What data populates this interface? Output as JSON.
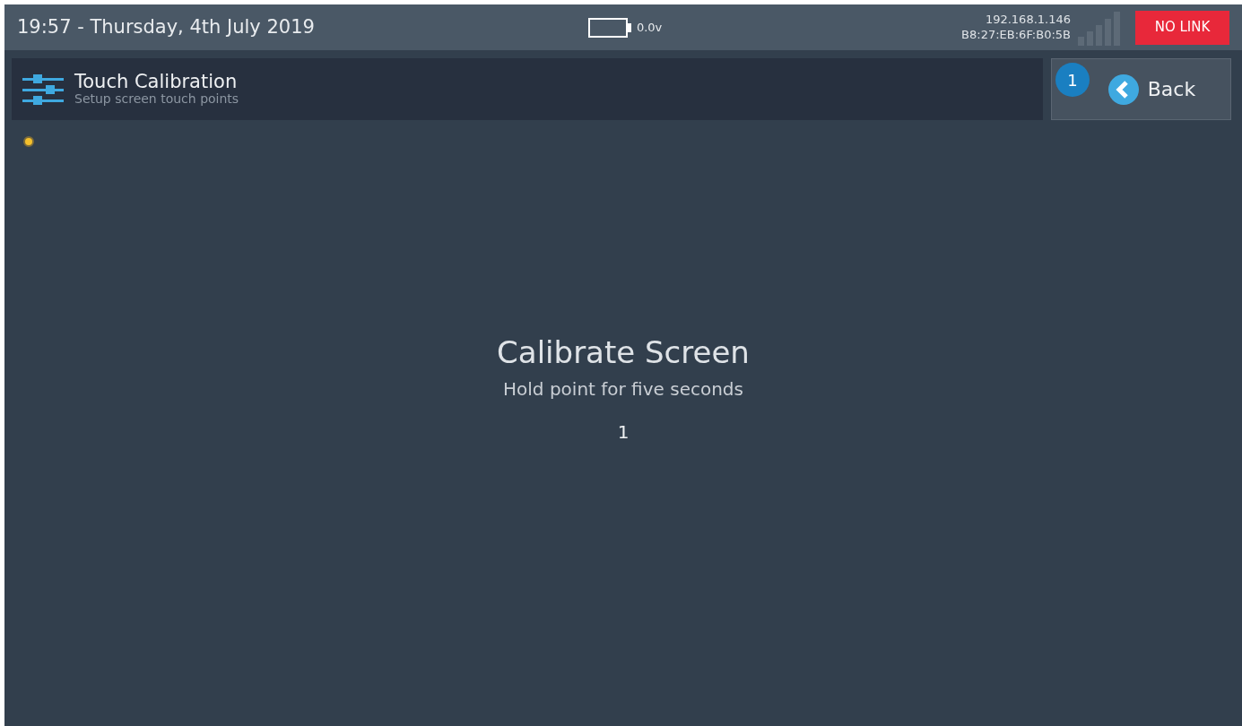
{
  "status_bar": {
    "datetime": "19:57 - Thursday, 4th July 2019",
    "voltage": "0.0v",
    "ip_address": "192.168.1.146",
    "mac_address": "B8:27:EB:6F:B0:5B",
    "link_status": "NO LINK"
  },
  "header": {
    "title": "Touch Calibration",
    "subtitle": "Setup screen touch points"
  },
  "back_button": {
    "label": "Back",
    "badge": "1"
  },
  "calibration": {
    "title": "Calibrate Screen",
    "instruction": "Hold point for five seconds",
    "point_number": "1"
  }
}
